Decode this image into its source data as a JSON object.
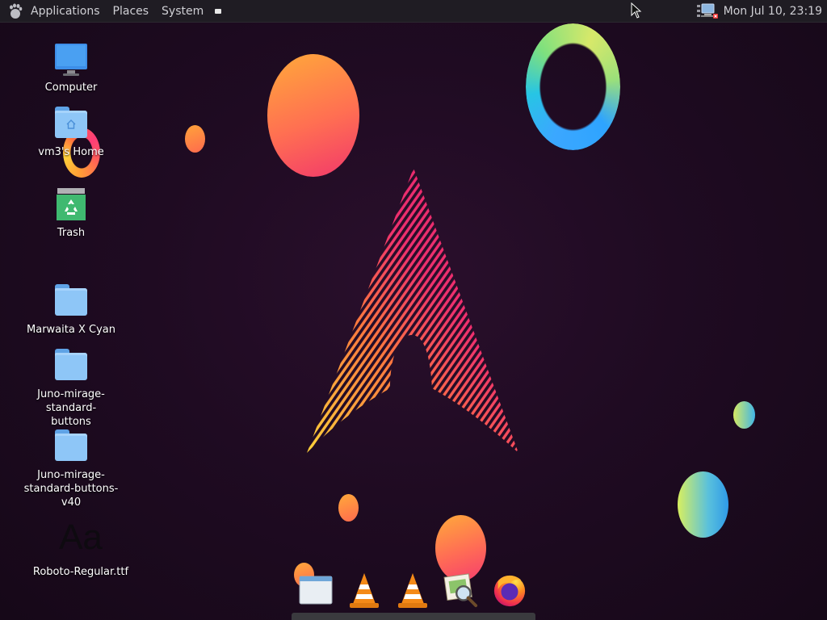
{
  "panel": {
    "menus": [
      "Applications",
      "Places",
      "System"
    ],
    "clock": "Mon Jul 10, 23:19"
  },
  "desktop": {
    "icons": [
      {
        "label": "Computer",
        "icon": "computer-icon"
      },
      {
        "label": "vm3's Home",
        "icon": "home-folder-icon"
      },
      {
        "label": "Trash",
        "icon": "trash-icon"
      },
      {
        "label": "Marwaita X Cyan",
        "icon": "folder-icon"
      },
      {
        "label": "Juno-mirage-standard-buttons",
        "icon": "folder-icon"
      },
      {
        "label": "Juno-mirage-standard-buttons-v40",
        "icon": "folder-icon"
      },
      {
        "label": "Roboto-Regular.ttf",
        "icon": "font-file-icon",
        "preview": "Aa"
      }
    ]
  },
  "dock": {
    "items": [
      "window-icon",
      "vlc-icon",
      "vlc-icon",
      "image-viewer-icon",
      "firefox-icon"
    ]
  },
  "colors": {
    "panel_bg": "#1f1c23",
    "background": "#1f0b22",
    "accent_pink": "#e0246e",
    "accent_orange": "#ff9d36",
    "folder_blue": "#8ec6f7"
  }
}
